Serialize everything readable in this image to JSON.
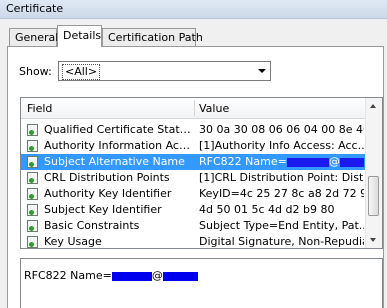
{
  "window": {
    "title": "Certificate"
  },
  "tabs": [
    {
      "label": "General"
    },
    {
      "label": "Details"
    },
    {
      "label": "Certification Path"
    }
  ],
  "show": {
    "label": "Show:",
    "value": "<All>"
  },
  "list": {
    "headers": {
      "field": "Field",
      "value": "Value"
    },
    "rows": [
      {
        "field": "Qualified Certificate Statem...",
        "value": "30 0a 30 08 06 06 04 00 8e 46..."
      },
      {
        "field": "Authority Information Access",
        "value": "[1]Authority Info Access: Acc..."
      },
      {
        "field": "Subject Alternative Name",
        "value": "RFC822 Name=",
        "value_after": "@"
      },
      {
        "field": "CRL Distribution Points",
        "value": "[1]CRL Distribution Point: Distr..."
      },
      {
        "field": "Authority Key Identifier",
        "value": "KeyID=4c 25 27 8c a8 2d 72 9e"
      },
      {
        "field": "Subject Key Identifier",
        "value": "4d 50 01 5c 4d d2 b9 80"
      },
      {
        "field": "Basic Constraints",
        "value": "Subject Type=End Entity, Pat..."
      },
      {
        "field": "Key Usage",
        "value": "Digital Signature, Non-Repudia"
      }
    ]
  },
  "detail": {
    "prefix": "RFC822 Name=",
    "at": "@"
  },
  "colors": {
    "selection": "#3399ff",
    "redaction": "#0000ee"
  },
  "icons": {
    "row_icon": "certificate-field-icon"
  }
}
